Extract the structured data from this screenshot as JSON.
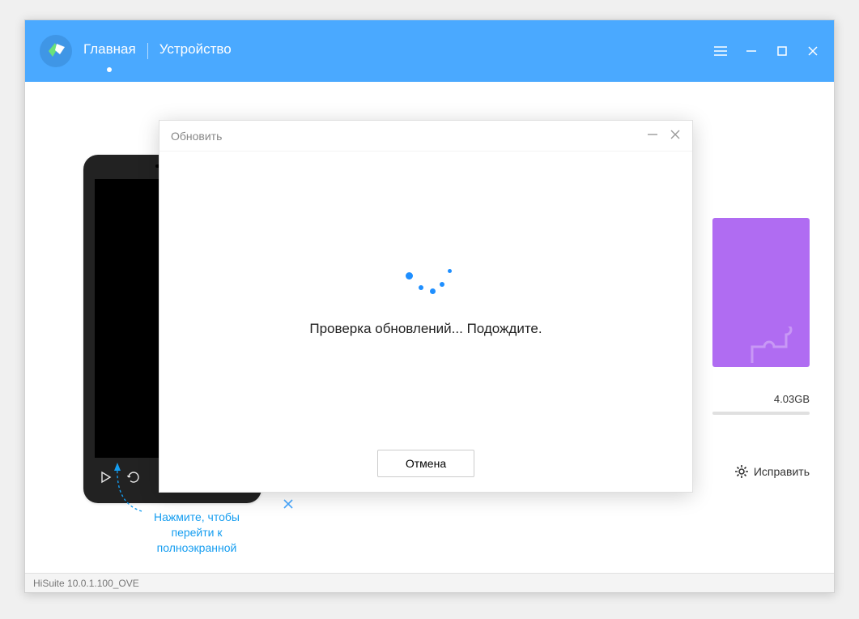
{
  "header": {
    "nav_home": "Главная",
    "nav_device": "Устройство"
  },
  "tooltip": {
    "text": "Нажмите, чтобы перейти к полноэкранной"
  },
  "storage": {
    "value": "4.03GB"
  },
  "fix": {
    "label": "Исправить"
  },
  "statusbar": {
    "version": "HiSuite 10.0.1.100_OVE"
  },
  "modal": {
    "title": "Обновить",
    "message": "Проверка обновлений... Подождите.",
    "cancel": "Отмена"
  },
  "colors": {
    "accent": "#4aa9ff",
    "purple": "#b06cf2"
  }
}
